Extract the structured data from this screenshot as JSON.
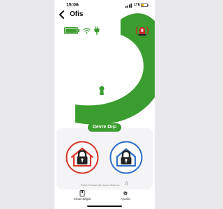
{
  "status_bar": {
    "time": "15:06",
    "network": "LTE"
  },
  "header": {
    "back_icon": "chevron-left-icon",
    "title": "Ofis"
  },
  "device_status": {
    "battery_icon": "battery-full-icon",
    "wifi_icon": "wifi-icon",
    "power_icon": "plug-icon",
    "alarm_icon": "alarm-siren-icon"
  },
  "main": {
    "lock_state_icon": "unlocked-padlock-icon",
    "status_label": "Devre Dışı",
    "arm_home_icon": "home-lock-icon",
    "arm_away_icon": "home-lock-icon",
    "hint": "Daha Fazlası İçin Uzun Basınız",
    "hint_icon": "long-press-icon"
  },
  "nav": {
    "device_label": "Cihaz Bilgisi",
    "device_icon": "book-icon",
    "settings_label": "Ayarlar",
    "settings_icon": "gear-icon"
  },
  "colors": {
    "brand_green": "#3b9c2f",
    "home_red": "#d6382c",
    "away_blue": "#2f6fc9",
    "alarm_red": "#c8242a"
  }
}
